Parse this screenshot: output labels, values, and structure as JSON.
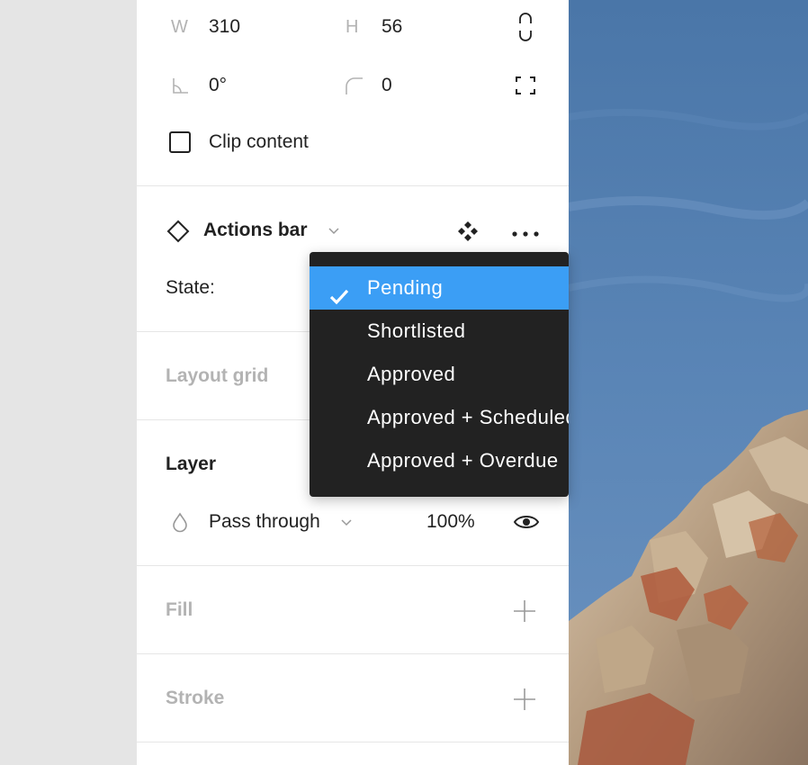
{
  "dimensions": {
    "w_label": "W",
    "w_value": "310",
    "h_label": "H",
    "h_value": "56",
    "rotation_value": "0°",
    "radius_value": "0"
  },
  "clip": {
    "label": "Clip content",
    "checked": false
  },
  "component": {
    "name": "Actions bar",
    "state_label": "State:",
    "options": [
      "Pending",
      "Shortlisted",
      "Approved",
      "Approved + Scheduled",
      "Approved + Overdue"
    ],
    "selected": "Pending"
  },
  "layout_grid": {
    "title": "Layout grid"
  },
  "layer": {
    "title": "Layer",
    "blend_mode": "Pass through",
    "opacity": "100%"
  },
  "fill": {
    "title": "Fill"
  },
  "stroke": {
    "title": "Stroke"
  },
  "colors": {
    "accent": "#3b9ef5",
    "menu_bg": "#222222"
  }
}
